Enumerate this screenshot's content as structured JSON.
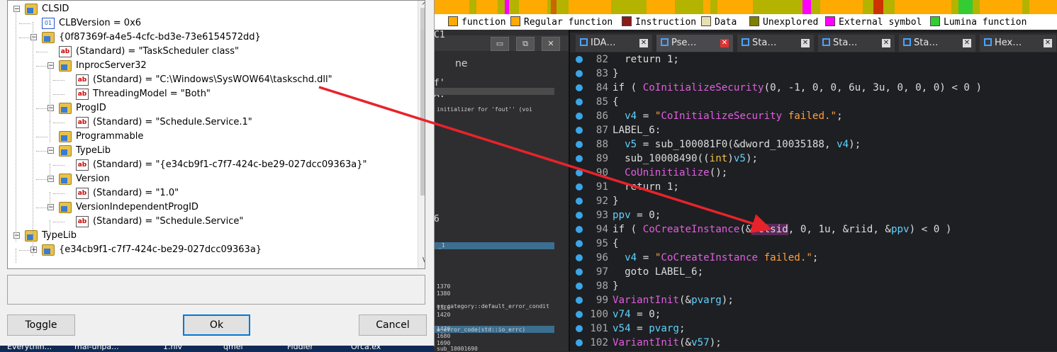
{
  "ida": {
    "legend": [
      {
        "label": "function",
        "color": "#ffaa00"
      },
      {
        "label": "Regular function",
        "color": "#ffaa00"
      },
      {
        "label": "Instruction",
        "color": "#8b1a1a"
      },
      {
        "label": "Data",
        "color": "#e8e0b0"
      },
      {
        "label": "Unexplored",
        "color": "#808000"
      },
      {
        "label": "External symbol",
        "color": "#ff00ff"
      },
      {
        "label": "Lumina function",
        "color": "#33cc33"
      }
    ],
    "left_pane": {
      "title_fragment": "ne",
      "c1_fragment": "C1",
      "f_fragment": "f'",
      "a_fragment": "A:",
      "six_fragment": "6",
      "initializer_text": "initializer for 'fout'' (voi",
      "item_1": "_1",
      "addrs": [
        "1370",
        "1380",
        "",
        "13E0",
        "1420",
        "",
        "1470",
        "1680",
        "1690"
      ],
      "error_category": "or_category::default_error_condit",
      "error_code": "e_error_code(std::io_errc)",
      "sub_label": "sub_10001690"
    },
    "tabs": [
      {
        "label": "IDA…",
        "active": false
      },
      {
        "label": "Pse…",
        "active": true
      },
      {
        "label": "Sta…",
        "active": false
      },
      {
        "label": "Sta…",
        "active": false
      },
      {
        "label": "Sta…",
        "active": false
      },
      {
        "label": "Hex…",
        "active": false
      }
    ],
    "code_lines": [
      {
        "ln": "82",
        "text": "  return 1;"
      },
      {
        "ln": "83",
        "text": "}"
      },
      {
        "ln": "84",
        "text": "if ( CoInitializeSecurity(0, -1, 0, 0, 6u, 3u, 0, 0, 0) < 0 )"
      },
      {
        "ln": "85",
        "text": "{"
      },
      {
        "ln": "86",
        "text": "  v4 = \"CoInitializeSecurity failed.\";"
      },
      {
        "ln": "87",
        "text": "LABEL_6:"
      },
      {
        "ln": "88",
        "text": "  v5 = sub_100081F0(&dword_10035188, v4);"
      },
      {
        "ln": "89",
        "text": "  sub_10008490((int)v5);"
      },
      {
        "ln": "90",
        "text": "  CoUninitialize();"
      },
      {
        "ln": "91",
        "text": "  return 1;"
      },
      {
        "ln": "92",
        "text": "}"
      },
      {
        "ln": "93",
        "text": "ppv = 0;"
      },
      {
        "ln": "94",
        "text": "if ( CoCreateInstance(&rclsid, 0, 1u, &riid, &ppv) < 0 )"
      },
      {
        "ln": "95",
        "text": "{"
      },
      {
        "ln": "96",
        "text": "  v4 = \"CoCreateInstance failed.\";"
      },
      {
        "ln": "97",
        "text": "  goto LABEL_6;"
      },
      {
        "ln": "98",
        "text": "}"
      },
      {
        "ln": "99",
        "text": "VariantInit(&pvarg);"
      },
      {
        "ln": "100",
        "text": "v74 = 0;"
      },
      {
        "ln": "101",
        "text": "v54 = pvarg;"
      },
      {
        "ln": "102",
        "text": "VariantInit(&v57);"
      }
    ]
  },
  "dialog": {
    "tree": [
      {
        "label": "CLSID",
        "icon": "folder-icon",
        "exp": "-"
      },
      {
        "label": "CLBVersion  = 0x6",
        "icon": "binary-value-icon",
        "exp": ""
      },
      {
        "label": "{0f87369f-a4e5-4cfc-bd3e-73e6154572dd}",
        "icon": "folder-icon",
        "exp": "-"
      },
      {
        "label": "(Standard) = \"TaskScheduler class\"",
        "icon": "string-value-icon",
        "exp": ""
      },
      {
        "label": "InprocServer32",
        "icon": "folder-icon",
        "exp": "-"
      },
      {
        "label": "(Standard) = \"C:\\Windows\\SysWOW64\\taskschd.dll\"",
        "icon": "string-value-icon",
        "exp": ""
      },
      {
        "label": "ThreadingModel = \"Both\"",
        "icon": "string-value-icon",
        "exp": ""
      },
      {
        "label": "ProgID",
        "icon": "folder-icon",
        "exp": "-"
      },
      {
        "label": "(Standard) = \"Schedule.Service.1\"",
        "icon": "string-value-icon",
        "exp": ""
      },
      {
        "label": "Programmable",
        "icon": "folder-icon",
        "exp": ""
      },
      {
        "label": "TypeLib",
        "icon": "folder-icon",
        "exp": "-"
      },
      {
        "label": "(Standard) = \"{e34cb9f1-c7f7-424c-be29-027dcc09363a}\"",
        "icon": "string-value-icon",
        "exp": ""
      },
      {
        "label": "Version",
        "icon": "folder-icon",
        "exp": "-"
      },
      {
        "label": "(Standard) = \"1.0\"",
        "icon": "string-value-icon",
        "exp": ""
      },
      {
        "label": "VersionIndependentProgID",
        "icon": "folder-icon",
        "exp": "-"
      },
      {
        "label": "(Standard) = \"Schedule.Service\"",
        "icon": "string-value-icon",
        "exp": ""
      },
      {
        "label": "TypeLib",
        "icon": "folder-icon",
        "exp": "-"
      },
      {
        "label": "{e34cb9f1-c7f7-424c-be29-027dcc09363a}",
        "icon": "folder-icon",
        "exp": "+"
      }
    ],
    "buttons": {
      "toggle": "Toggle",
      "ok": "Ok",
      "cancel": "Cancel"
    },
    "scroll_down": "v",
    "scroll_up": "^"
  },
  "taskbar": {
    "items": [
      "Everythin...",
      "mal-unpa...",
      "1.hiv",
      "qmei",
      "Fiddler",
      "Orca.ex"
    ]
  },
  "annotation": {
    "color": "#e8232a"
  }
}
